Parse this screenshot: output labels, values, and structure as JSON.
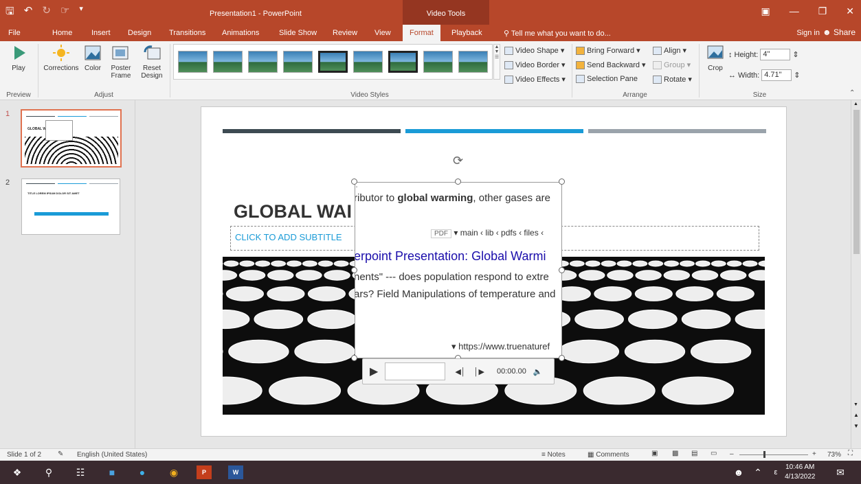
{
  "window": {
    "title": "Presentation1 - PowerPoint",
    "context_group": "Video Tools",
    "qat_icons": [
      "save-icon",
      "undo-icon",
      "redo-icon",
      "touch-mode-icon",
      "customize-icon"
    ]
  },
  "tabs": [
    "File",
    "Home",
    "Insert",
    "Design",
    "Transitions",
    "Animations",
    "Slide Show",
    "Review",
    "View",
    "Format",
    "Playback"
  ],
  "active_tab": "Format",
  "tell_me": "Tell me what you want to do...",
  "sign_in": "Sign in",
  "share": "Share",
  "ribbon": {
    "preview": {
      "label": "Preview",
      "play": "Play"
    },
    "adjust": {
      "label": "Adjust",
      "corrections": "Corrections",
      "color": "Color",
      "poster_frame_1": "Poster",
      "poster_frame_2": "Frame",
      "reset_design_1": "Reset",
      "reset_design_2": "Design"
    },
    "video_styles": {
      "label": "Video Styles",
      "thumb_count": 9
    },
    "video_options": {
      "shape": "Video Shape",
      "border": "Video Border",
      "effects": "Video Effects"
    },
    "arrange": {
      "label": "Arrange",
      "bring_forward": "Bring Forward",
      "send_backward": "Send Backward",
      "selection_pane": "Selection Pane",
      "align": "Align",
      "group": "Group",
      "rotate": "Rotate"
    },
    "size": {
      "label": "Size",
      "crop": "Crop",
      "height_label": "Height:",
      "height_value": "4\"",
      "width_label": "Width:",
      "width_value": "4.71\""
    }
  },
  "thumbnails": [
    {
      "num": "1",
      "title": "GLOBAL WAI",
      "selected": true
    },
    {
      "num": "2",
      "title": "TITLE LOREM IPSUM DOLOR SIT AMET",
      "selected": false
    }
  ],
  "slide": {
    "title": "GLOBAL WAI",
    "subtitle_placeholder": "CLICK TO ADD SUBTITLE",
    "bar_colors": [
      "#3d4a52",
      "#1a9bd7",
      "#9aa3ab"
    ]
  },
  "web_video": {
    "line1_pre": "ributor to ",
    "line1_bold": "global warming",
    "line1_post": ", other gases are",
    "pdf_badge": "PDF",
    "breadcrumb": "main ‹ lib ‹ pdfs ‹ files ‹",
    "link": "erpoint Presentation: Global Warmi",
    "line3": "nents\" --- does population respond to extre",
    "line4": "ars? Field Manipulations of temperature and",
    "url": "https://www.truenaturef"
  },
  "player": {
    "time": "00:00.00"
  },
  "status": {
    "slide_of": "Slide 1 of 2",
    "language": "English (United States)",
    "notes": "Notes",
    "comments": "Comments",
    "zoom": "73%",
    "zoom_fraction": 0.35
  },
  "taskbar": {
    "time": "10:46 AM",
    "date": "4/13/2022",
    "lang": "ε"
  }
}
